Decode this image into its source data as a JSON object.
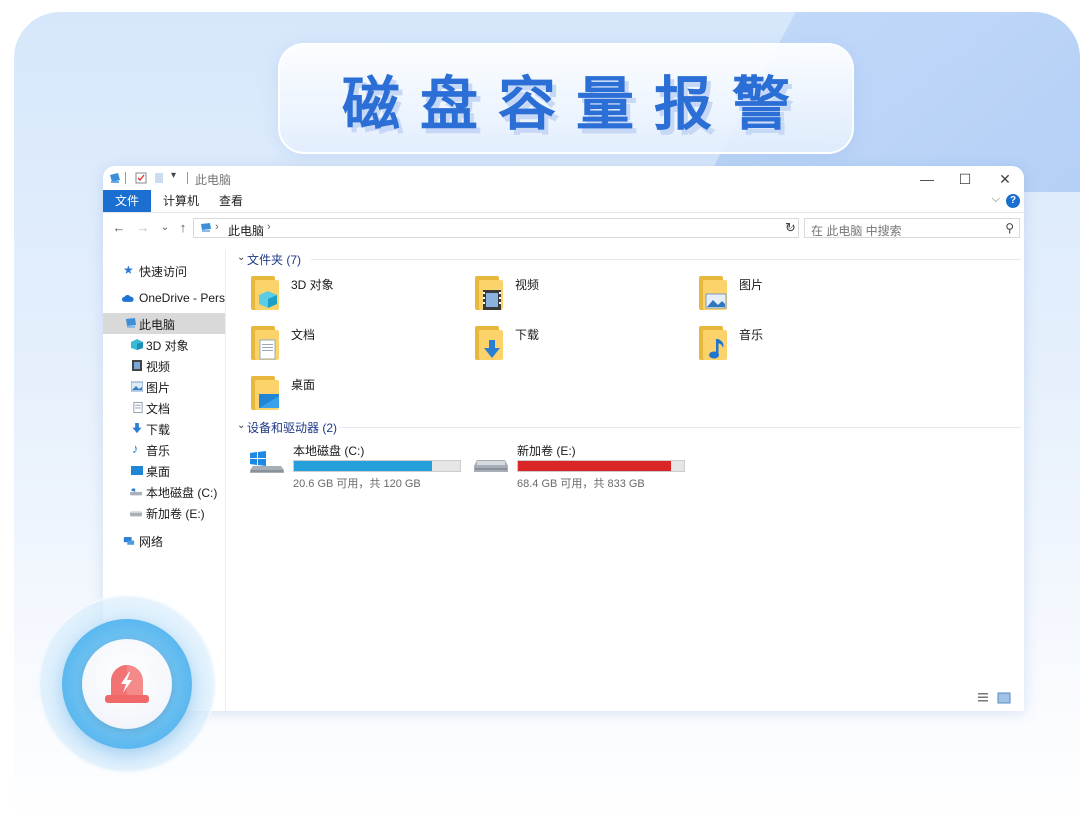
{
  "banner": {
    "title": "磁盘容量报警"
  },
  "window": {
    "title": "此电脑",
    "controls": {
      "minimize": "—",
      "maximize": "☐",
      "close": "✕"
    },
    "ribbon_tabs": [
      "文件",
      "计算机",
      "查看"
    ],
    "help": "?",
    "address": {
      "crumb": "此电脑"
    },
    "search_placeholder": "在 此电脑 中搜索"
  },
  "sidebar": {
    "items": [
      {
        "label": "快速访问",
        "icon": "star-icon"
      },
      {
        "label": "OneDrive - Personal",
        "icon": "cloud-icon"
      },
      {
        "label": "此电脑",
        "icon": "computer-icon"
      },
      {
        "label": "3D 对象",
        "icon": "cube-icon"
      },
      {
        "label": "视频",
        "icon": "video-icon"
      },
      {
        "label": "图片",
        "icon": "picture-icon"
      },
      {
        "label": "文档",
        "icon": "document-icon"
      },
      {
        "label": "下载",
        "icon": "download-icon"
      },
      {
        "label": "音乐",
        "icon": "music-icon"
      },
      {
        "label": "桌面",
        "icon": "desktop-icon"
      },
      {
        "label": "本地磁盘 (C:)",
        "icon": "drive-icon"
      },
      {
        "label": "新加卷 (E:)",
        "icon": "drive-icon"
      },
      {
        "label": "网络",
        "icon": "network-icon"
      }
    ]
  },
  "content": {
    "folders_header": "文件夹 (7)",
    "folders": [
      {
        "label": "3D 对象",
        "icon": "cube-icon"
      },
      {
        "label": "视频",
        "icon": "video-icon"
      },
      {
        "label": "图片",
        "icon": "picture-icon"
      },
      {
        "label": "文档",
        "icon": "document-icon"
      },
      {
        "label": "下载",
        "icon": "download-icon"
      },
      {
        "label": "音乐",
        "icon": "music-icon"
      },
      {
        "label": "桌面",
        "icon": "desktop-icon"
      }
    ],
    "drives_header": "设备和驱动器 (2)",
    "drives": [
      {
        "name": "本地磁盘 (C:)",
        "info": "20.6 GB 可用，共 120 GB",
        "used_fraction": 0.83,
        "bar_color": "#26a0da"
      },
      {
        "name": "新加卷 (E:)",
        "info": "68.4 GB 可用，共 833 GB",
        "used_fraction": 0.92,
        "bar_color": "#da2626"
      }
    ]
  },
  "colors": {
    "accent": "#2b6fd6",
    "file_tab": "#1a6fd0",
    "alarm": "#f26b6b"
  }
}
